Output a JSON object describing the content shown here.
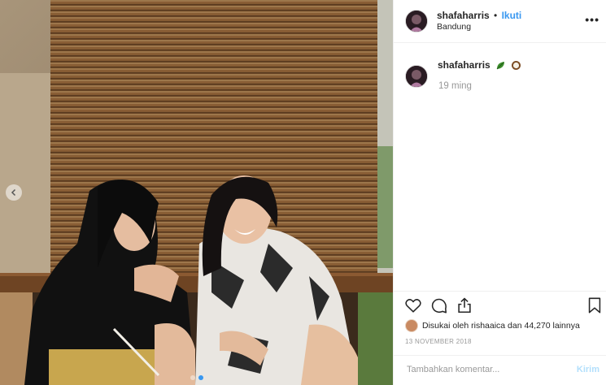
{
  "post": {
    "username": "shafaharris",
    "separator": "•",
    "follow_label": "Ikuti",
    "location": "Bandung",
    "more_label": "•••",
    "caption_username": "shafaharris",
    "caption_emojis": [
      "leaf-emoji",
      "coconut-emoji"
    ],
    "time_ago": "19 ming",
    "likes_text": "Disukai oleh rishaaica dan 44,270 lainnya",
    "date": "13 NOVEMBER 2018",
    "comment_placeholder": "Tambahkan komentar...",
    "post_label": "Kirim",
    "carousel": {
      "total": 2,
      "active": 2
    }
  },
  "icons": {
    "like": "heart-icon",
    "comment": "comment-icon",
    "share": "share-icon",
    "save": "bookmark-icon",
    "prev": "chevron-left-icon"
  },
  "colors": {
    "accent": "#3897f0",
    "muted": "#999999",
    "border": "#efefef",
    "text": "#262626"
  }
}
